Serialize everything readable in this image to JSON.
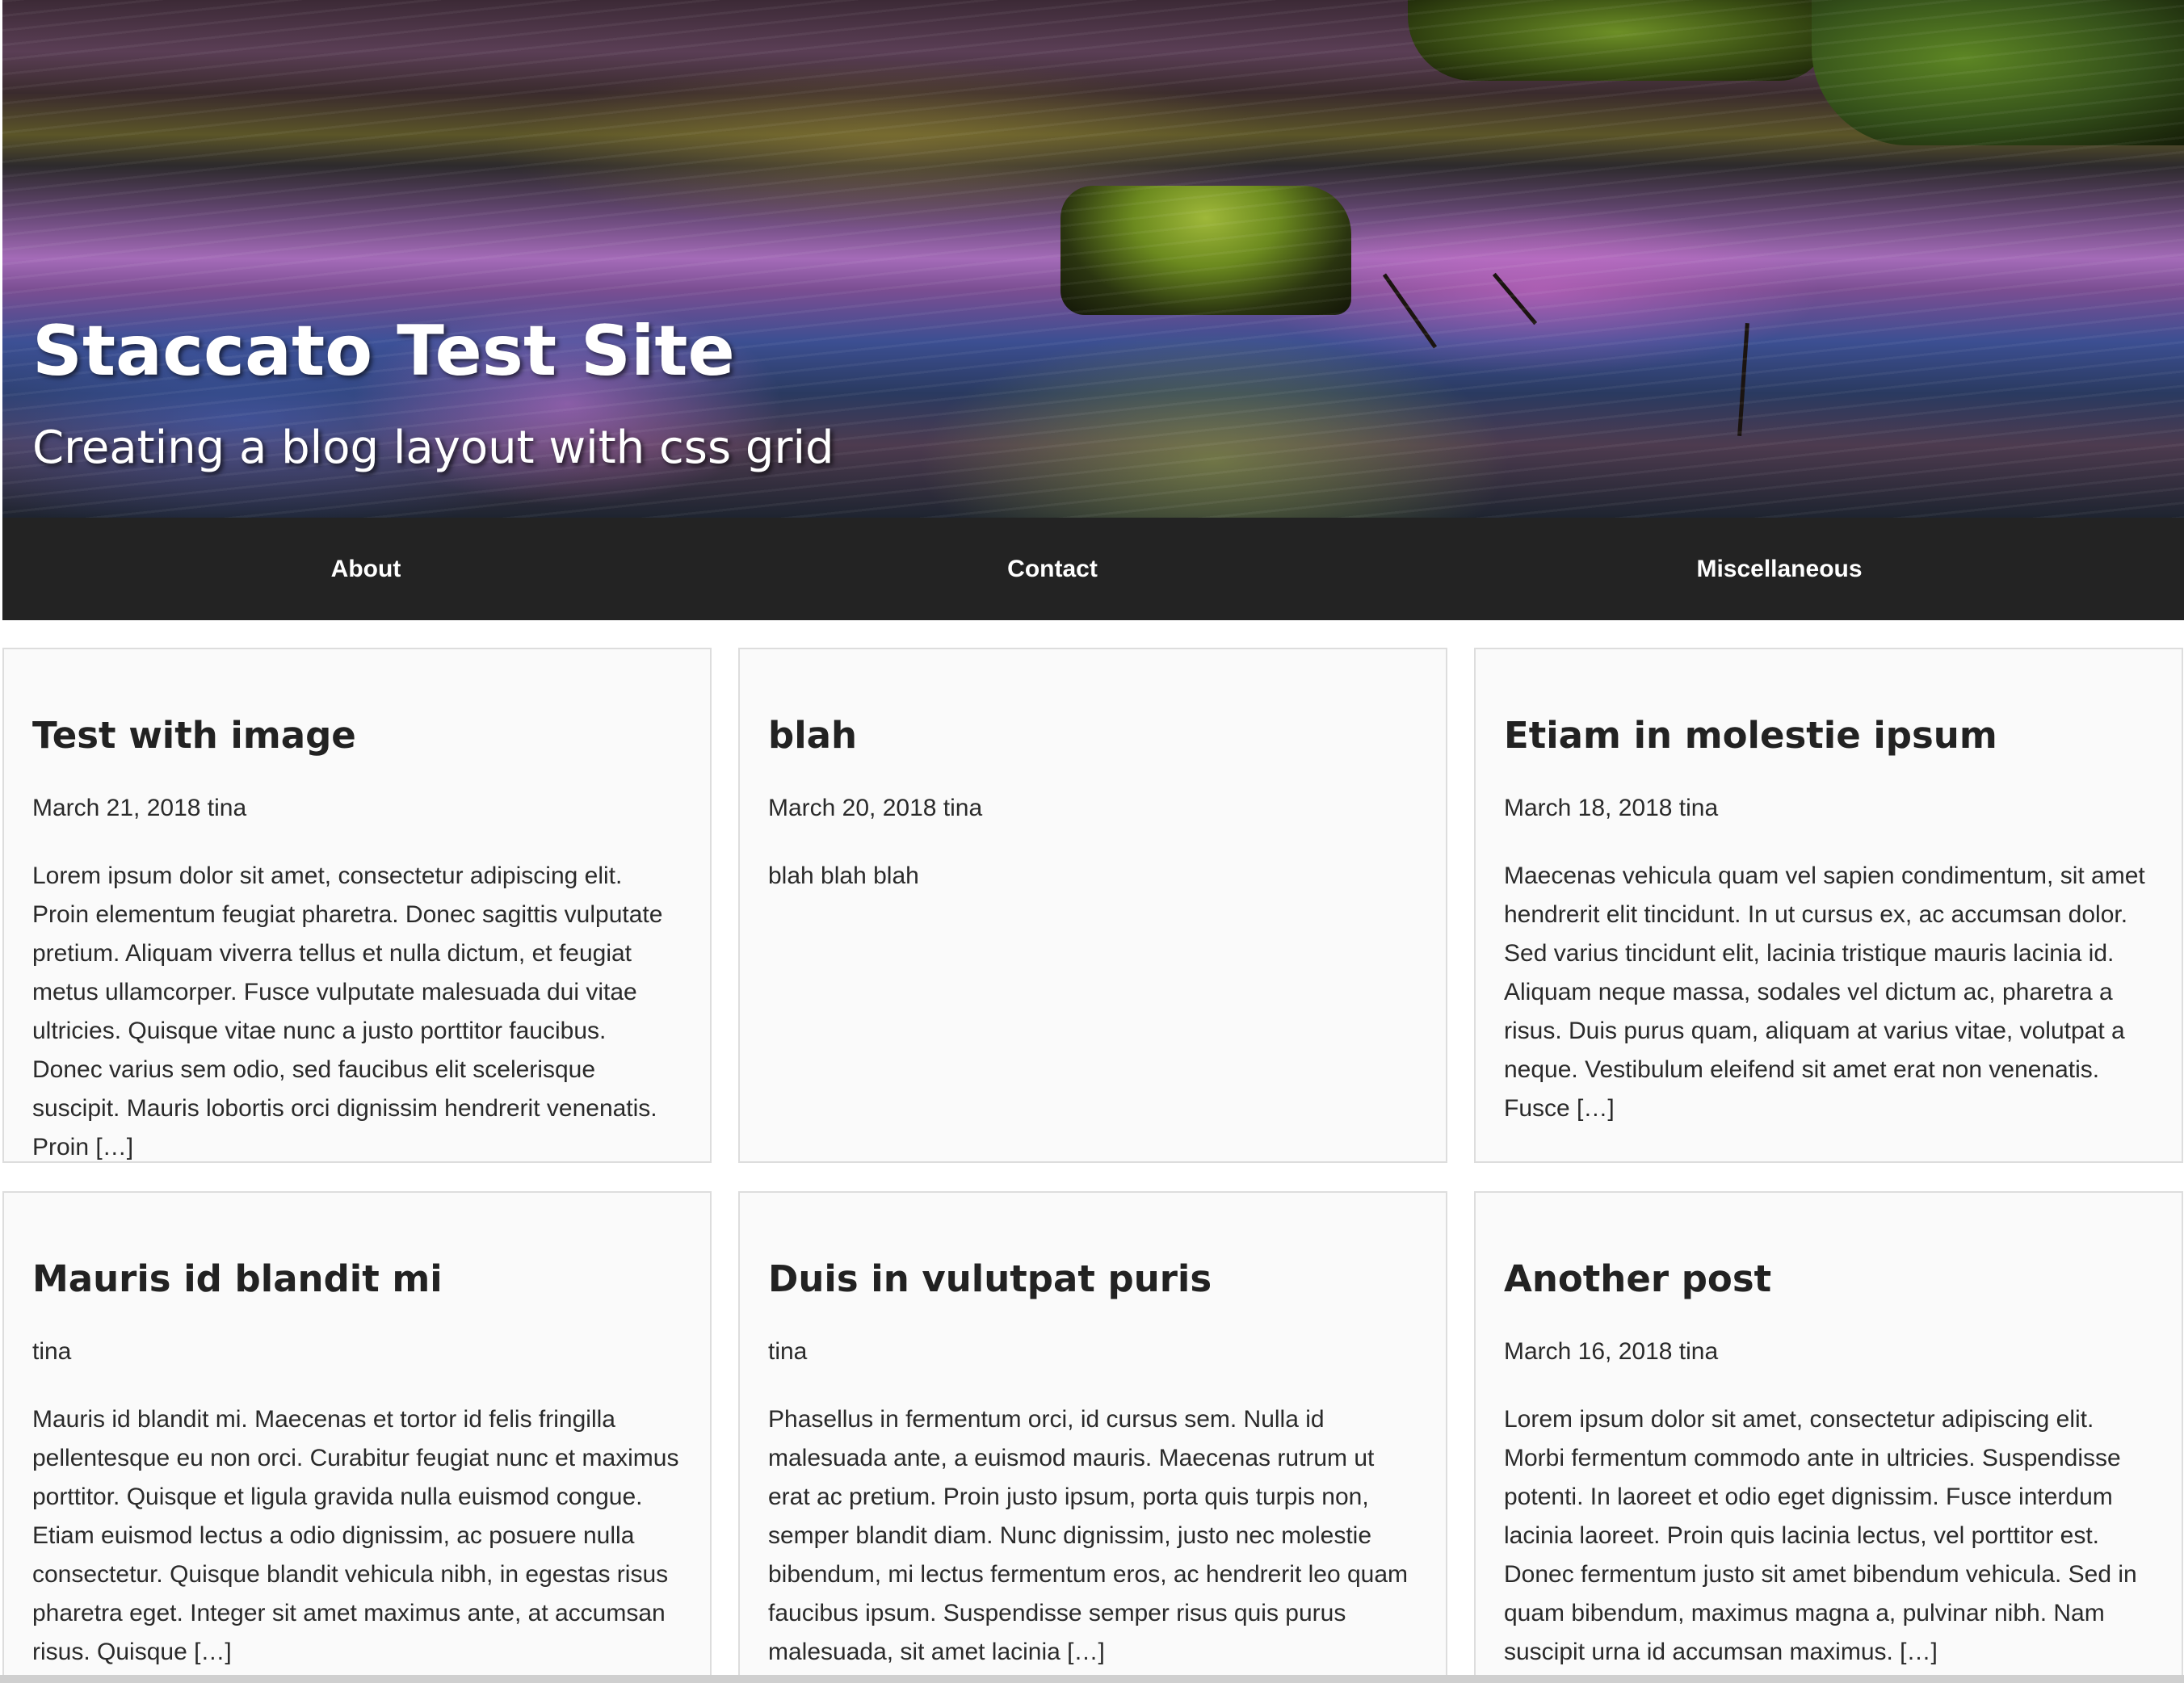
{
  "site": {
    "title": "Staccato Test Site",
    "tagline": "Creating a blog layout with css grid"
  },
  "nav": {
    "items": [
      "About",
      "Contact",
      "Miscellaneous"
    ]
  },
  "posts": [
    {
      "title": "Test with image",
      "meta": "March 21, 2018 tina",
      "excerpt": "Lorem ipsum dolor sit amet, consectetur adipiscing elit. Proin elementum feugiat pharetra. Donec sagittis vulputate pretium. Aliquam viverra tellus et nulla dictum, et feugiat metus ullamcorper. Fusce vulputate malesuada dui vitae ultricies. Quisque vitae nunc a justo porttitor faucibus. Donec varius sem odio, sed faucibus elit scelerisque suscipit. Mauris lobortis orci dignissim hendrerit venenatis. Proin […]"
    },
    {
      "title": "blah",
      "meta": "March 20, 2018 tina",
      "excerpt": "blah blah blah"
    },
    {
      "title": "Etiam in molestie ipsum",
      "meta": "March 18, 2018 tina",
      "excerpt": "Maecenas vehicula quam vel sapien condimentum, sit amet hendrerit elit tincidunt. In ut cursus ex, ac accumsan dolor. Sed varius tincidunt elit, lacinia tristique mauris lacinia id. Aliquam neque massa, sodales vel dictum ac, pharetra a risus. Duis purus quam, aliquam at varius vitae, volutpat a neque. Vestibulum eleifend sit amet erat non venenatis. Fusce […]"
    },
    {
      "title": "Mauris id blandit mi",
      "meta": "tina",
      "excerpt": "Mauris id blandit mi. Maecenas et tortor id felis fringilla pellentesque eu non orci. Curabitur feugiat nunc et maximus porttitor. Quisque et ligula gravida nulla euismod congue. Etiam euismod lectus a odio dignissim, ac posuere nulla consectetur. Quisque blandit vehicula nibh, in egestas risus pharetra eget. Integer sit amet maximus ante, at accumsan risus. Quisque […]"
    },
    {
      "title": "Duis in vulutpat puris",
      "meta": "tina",
      "excerpt": "Phasellus in fermentum orci, id cursus sem. Nulla id malesuada ante, a euismod mauris. Maecenas rutrum ut erat ac pretium. Proin justo ipsum, porta quis turpis non, semper blandit diam. Nunc dignissim, justo nec molestie bibendum, mi lectus fermentum eros, ac hendrerit leo quam faucibus ipsum. Suspendisse semper risus quis purus malesuada, sit amet lacinia […]"
    },
    {
      "title": "Another post",
      "meta": "March 16, 2018 tina",
      "excerpt": "Lorem ipsum dolor sit amet, consectetur adipiscing elit. Morbi fermentum commodo ante in ultricies. Suspendisse potenti. In laoreet et odio eget dignissim. Fusce interdum lacinia laoreet. Proin quis lacinia lectus, vel porttitor est. Donec fermentum justo sit amet bibendum vehicula. Sed in quam bibendum, maximus magna a, pulvinar nibh. Nam suscipit urna id accumsan maximus. […]"
    }
  ]
}
